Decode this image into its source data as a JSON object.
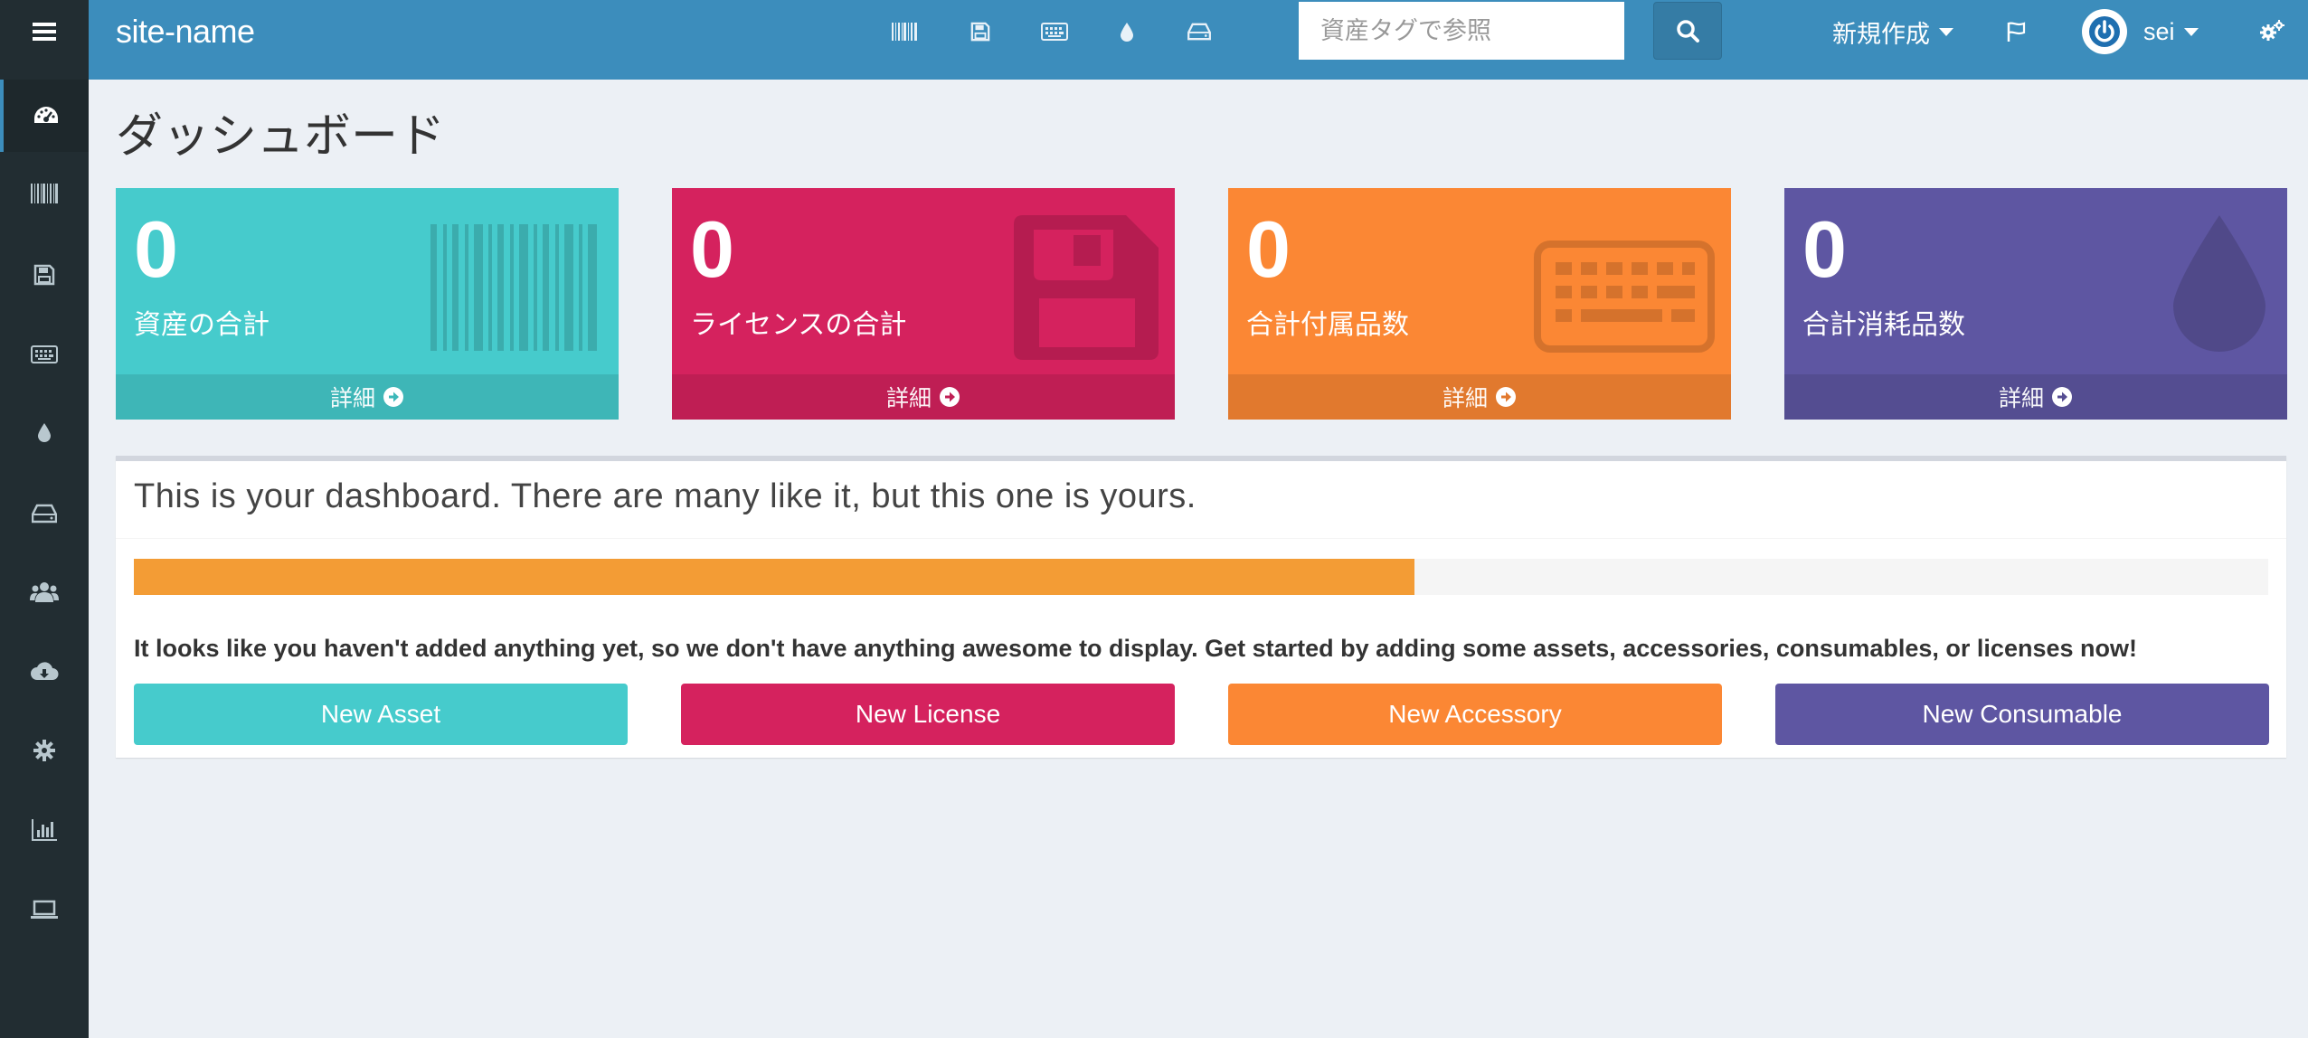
{
  "colors": {
    "sidebar_bg": "#222d32",
    "header_bg": "#3c8dbc",
    "page_bg": "#ecf0f5",
    "teal": "#46cbcc",
    "crimson": "#d5225e",
    "orange": "#fb8734",
    "purple": "#5e56a2",
    "progress": "#f39c35"
  },
  "header": {
    "site_name": "site-name",
    "search_placeholder": "資産タグで参照",
    "create_new_label": "新規作成",
    "username": "sei",
    "icons": [
      "barcode-icon",
      "floppy-icon",
      "keyboard-icon",
      "drop-icon",
      "drive-icon"
    ]
  },
  "sidebar": {
    "items": [
      {
        "icon": "dashboard-icon",
        "active": true
      },
      {
        "icon": "barcode-icon"
      },
      {
        "icon": "floppy-icon"
      },
      {
        "icon": "keyboard-icon"
      },
      {
        "icon": "drop-icon"
      },
      {
        "icon": "drive-icon"
      },
      {
        "icon": "users-icon"
      },
      {
        "icon": "cloud-download-icon"
      },
      {
        "icon": "gear-icon"
      },
      {
        "icon": "bar-chart-icon"
      },
      {
        "icon": "laptop-icon"
      }
    ]
  },
  "page": {
    "title": "ダッシュボード"
  },
  "stats": [
    {
      "count": "0",
      "label": "資産の合計",
      "footer": "詳細",
      "icon": "barcode-icon"
    },
    {
      "count": "0",
      "label": "ライセンスの合計",
      "footer": "詳細",
      "icon": "floppy-icon"
    },
    {
      "count": "0",
      "label": "合計付属品数",
      "footer": "詳細",
      "icon": "keyboard-icon"
    },
    {
      "count": "0",
      "label": "合計消耗品数",
      "footer": "詳細",
      "icon": "drop-icon"
    }
  ],
  "panel": {
    "title": "This is your dashboard. There are many like it, but this one is yours.",
    "progress_fraction": 0.6,
    "message": "It looks like you haven't added anything yet, so we don't have anything awesome to display. Get started by adding some assets, accessories, consumables, or licenses now!",
    "buttons": [
      {
        "label": "New Asset"
      },
      {
        "label": "New License"
      },
      {
        "label": "New Accessory"
      },
      {
        "label": "New Consumable"
      }
    ]
  }
}
